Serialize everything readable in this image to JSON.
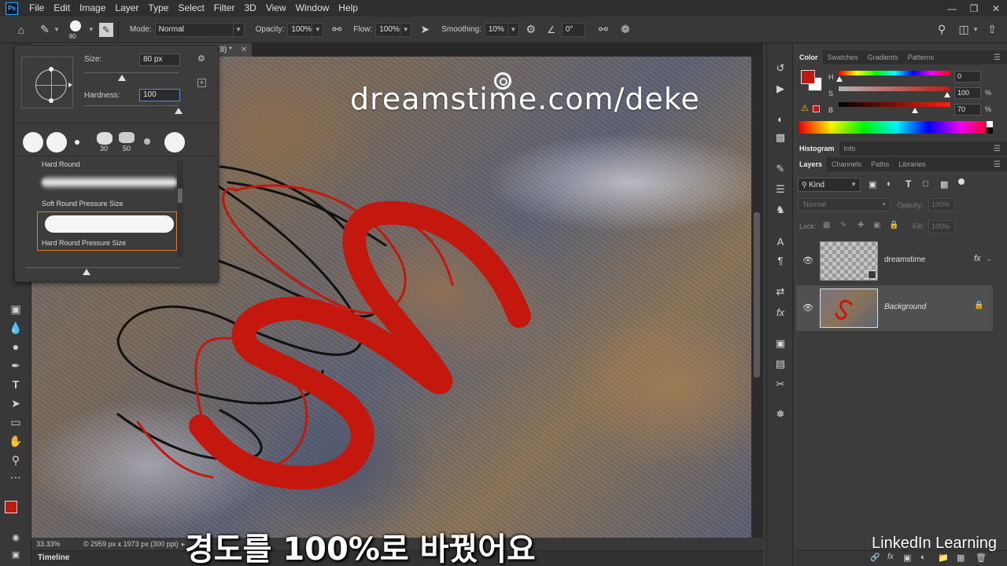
{
  "app": {
    "logo_text": "Ps"
  },
  "menu": [
    "File",
    "Edit",
    "Image",
    "Layer",
    "Type",
    "Select",
    "Filter",
    "3D",
    "View",
    "Window",
    "Help"
  ],
  "options_bar": {
    "brush_size": "80",
    "mode_label": "Mode:",
    "mode_value": "Normal",
    "opacity_label": "Opacity:",
    "opacity_value": "100%",
    "flow_label": "Flow:",
    "flow_value": "100%",
    "smoothing_label": "Smoothing:",
    "smoothing_value": "10%",
    "angle_value": "0°"
  },
  "document": {
    "tab_title": "(8) *",
    "watermark": "dreamstime.com/deke",
    "zoom": "33.33%",
    "doc_info": "© 2959 px x 1973 px (300 ppi)"
  },
  "timeline": {
    "label": "Timeline"
  },
  "brush_picker": {
    "size_label": "Size:",
    "size_value": "80 px",
    "size_level_percent": 40,
    "hardness_label": "Hardness:",
    "hardness_value": "100",
    "hardness_level_percent": 100,
    "tip_numbers": [
      "30",
      "50"
    ],
    "presets": [
      {
        "name": "Hard Round"
      },
      {
        "name": "Soft Round Pressure Size"
      },
      {
        "name": "Hard Round Pressure Size"
      }
    ]
  },
  "color_panel": {
    "tabs": [
      "Color",
      "Swatches",
      "Gradients",
      "Patterns"
    ],
    "foreground": "#c01a10",
    "background": "#ffffff",
    "h_label": "H",
    "h_value": "0",
    "s_label": "S",
    "s_value": "100",
    "b_label": "B",
    "b_value": "70",
    "percent_unit": "%"
  },
  "histogram_panel": {
    "tabs": [
      "Histogram",
      "Info"
    ]
  },
  "layers_panel": {
    "tabs": [
      "Layers",
      "Channels",
      "Paths",
      "Libraries"
    ],
    "filter_kind": "Kind",
    "blend_mode": "Normal",
    "opacity_label": "Opacity:",
    "opacity_value": "100%",
    "lock_label": "Lock:",
    "fill_label": "Fill:",
    "fill_value": "100%",
    "layers": [
      {
        "name": "dreamstime",
        "fx": "fx"
      },
      {
        "name": "Background"
      }
    ]
  },
  "subtitle": "경도를 100%로 바꿨어요",
  "branding": "LinkedIn Learning"
}
